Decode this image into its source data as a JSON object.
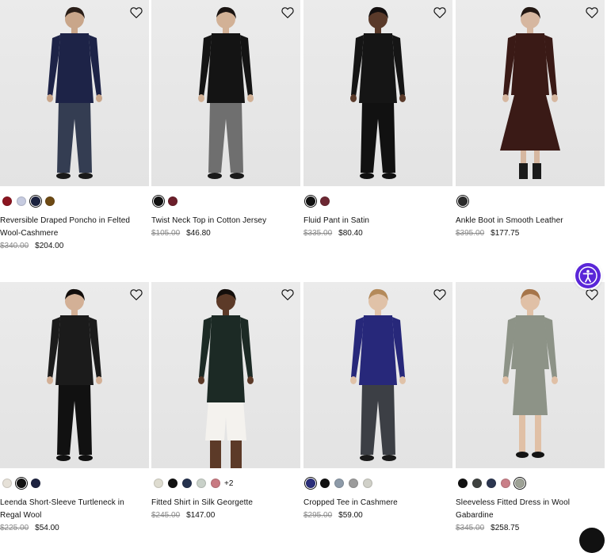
{
  "products": [
    {
      "name": "Reversible Draped Poncho in Felted Wool-Cashmere",
      "old_price": "$340.00",
      "new_price": "$204.00",
      "swatches": [
        "#8b1520",
        "#c6cbe0",
        "#1c2340",
        "#6e4a14"
      ],
      "selected": 2,
      "more": "",
      "figure": {
        "top": "#1d2347",
        "bottom": "#343d52",
        "shoes": "#1a1a1a",
        "skin": "#c9a68a",
        "hair": "#2a1e18"
      }
    },
    {
      "name": "Twist Neck Top in Cotton Jersey",
      "old_price": "$105.00",
      "new_price": "$46.80",
      "swatches": [
        "#111111",
        "#6c1f2b"
      ],
      "selected": 0,
      "more": "",
      "figure": {
        "top": "#141414",
        "bottom": "#6f6f6f",
        "shoes": "#1a1a1a",
        "skin": "#d2b196",
        "hair": "#1a1412"
      }
    },
    {
      "name": "Fluid Pant in Satin",
      "old_price": "$335.00",
      "new_price": "$80.40",
      "swatches": [
        "#111111",
        "#6d2833"
      ],
      "selected": 0,
      "more": "",
      "figure": {
        "top": "#151515",
        "bottom": "#111111",
        "shoes": "#111111",
        "skin": "#5a3a2a",
        "hair": "#141010"
      }
    },
    {
      "name": "Ankle Boot in Smooth Leather",
      "old_price": "$395.00",
      "new_price": "$177.75",
      "swatches": [
        "#2b2b2b"
      ],
      "selected": 0,
      "more": "",
      "figure": {
        "top": "#3a1a16",
        "bottom": "#3a1a16",
        "shoes": "#1a1a1a",
        "skin": "#d6b7a0",
        "hair": "#231813"
      }
    },
    {
      "name": "Leenda Short-Sleeve Turtleneck in Regal Wool",
      "old_price": "$225.00",
      "new_price": "$54.00",
      "swatches": [
        "#e6e1d8",
        "#111111",
        "#1d2340"
      ],
      "selected": 1,
      "more": "",
      "figure": {
        "top": "#1b1b1b",
        "bottom": "#111111",
        "shoes": "#111111",
        "skin": "#d3b096",
        "hair": "#120e0c"
      }
    },
    {
      "name": "Fitted Shirt in Silk Georgette",
      "old_price": "$245.00",
      "new_price": "$147.00",
      "swatches": [
        "#dedcd0",
        "#111111",
        "#25324e",
        "#c9d1c9",
        "#c87a82"
      ],
      "selected": -1,
      "more": "+2",
      "figure": {
        "top": "#1c2a25",
        "bottom": "#f4f2ee",
        "shoes": "#111111",
        "skin": "#5c3a28",
        "hair": "#140f0c"
      }
    },
    {
      "name": "Cropped Tee in Cashmere",
      "old_price": "$295.00",
      "new_price": "$59.00",
      "swatches": [
        "#2a2e7a",
        "#111111",
        "#8d9aa8",
        "#9b9b9b",
        "#d0d0c8"
      ],
      "selected": 0,
      "more": "",
      "figure": {
        "top": "#27287a",
        "bottom": "#3c3f45",
        "shoes": "#1a1a1a",
        "skin": "#e0c2a8",
        "hair": "#b48a5a"
      }
    },
    {
      "name": "Sleeveless Fitted Dress in Wool Gabardine",
      "old_price": "$345.00",
      "new_price": "$258.75",
      "swatches": [
        "#111111",
        "#3f4240",
        "#2c3650",
        "#c97f88",
        "#9ea296"
      ],
      "selected": 4,
      "more": "",
      "figure": {
        "top": "#8d9387",
        "bottom": "#8d9387",
        "shoes": "#141414",
        "skin": "#e0c0a6",
        "hair": "#a6754a"
      }
    }
  ]
}
